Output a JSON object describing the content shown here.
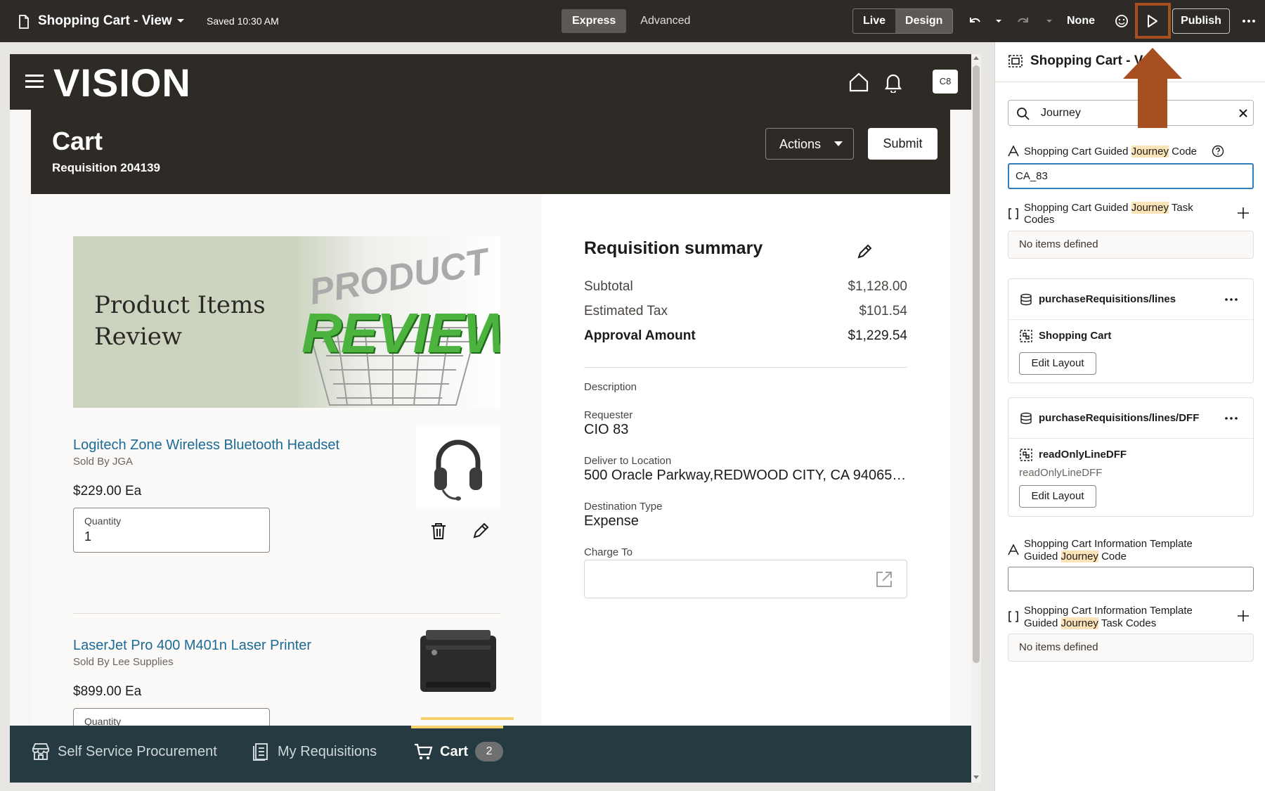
{
  "topbar": {
    "title": "Shopping Cart - View",
    "saved": "Saved 10:30 AM",
    "mode_express": "Express",
    "mode_advanced": "Advanced",
    "live": "Live",
    "design": "Design",
    "none": "None",
    "publish": "Publish"
  },
  "app": {
    "logo": "VISION",
    "avatar": "C8"
  },
  "cart": {
    "title": "Cart",
    "requisition": "Requisition 204139",
    "actions": "Actions",
    "submit": "Submit"
  },
  "banner": {
    "line1": "Product Items",
    "line2": "Review",
    "art_text1": "PRODUCT",
    "art_text2": "REVIEWS"
  },
  "items": [
    {
      "name": "Logitech Zone Wireless Bluetooth Headset",
      "seller": "Sold By JGA",
      "price": "$229.00 Ea",
      "qty_label": "Quantity",
      "qty": "1"
    },
    {
      "name": "LaserJet Pro 400 M401n Laser Printer",
      "seller": "Sold By Lee Supplies",
      "price": "$899.00 Ea",
      "qty_label": "Quantity"
    }
  ],
  "summary": {
    "title": "Requisition summary",
    "subtotal_label": "Subtotal",
    "subtotal": "$1,128.00",
    "tax_label": "Estimated Tax",
    "tax": "$101.54",
    "approval_label": "Approval Amount",
    "approval": "$1,229.54",
    "description_label": "Description",
    "requester_label": "Requester",
    "requester": "CIO 83",
    "deliver_label": "Deliver to Location",
    "deliver": "500 Oracle Parkway,REDWOOD CITY, CA 94065…",
    "dest_label": "Destination Type",
    "dest": "Expense",
    "charge_label": "Charge To"
  },
  "bottomnav": {
    "ssp": "Self Service Procurement",
    "myreq": "My Requisitions",
    "cart": "Cart",
    "cart_count": "2"
  },
  "panel": {
    "title": "Shopping Cart - V",
    "search_value": "Journey",
    "f1_pre": "Shopping Cart Guided ",
    "f1_hl": "Journey",
    "f1_post": " Code",
    "f1_value": "CA_83",
    "f2_pre": "Shopping Cart Guided ",
    "f2_hl": "Journey",
    "f2_post": " Task",
    "f2_line2": "Codes",
    "no_items": "No items defined",
    "card1_source": "purchaseRequisitions/lines",
    "card1_item": "Shopping Cart",
    "edit_layout": "Edit Layout",
    "card2_source": "purchaseRequisitions/lines/DFF",
    "card2_item": "readOnlyLineDFF",
    "card2_sub": "readOnlyLineDFF",
    "f3_line1": "Shopping Cart Information Template",
    "f3_pre": "Guided ",
    "f3_hl": "Journey",
    "f3_post": " Code",
    "f4_line1": "Shopping Cart Information Template",
    "f4_pre": "Guided ",
    "f4_hl": "Journey",
    "f4_post": " Task Codes"
  },
  "colors": {
    "topbar": "#2d2a27",
    "app_header": "#2e2a26",
    "bottom_nav": "#253b41",
    "link": "#1c6a96",
    "highlight_annotation": "#a84f22",
    "search_highlight": "#fce3b8"
  }
}
